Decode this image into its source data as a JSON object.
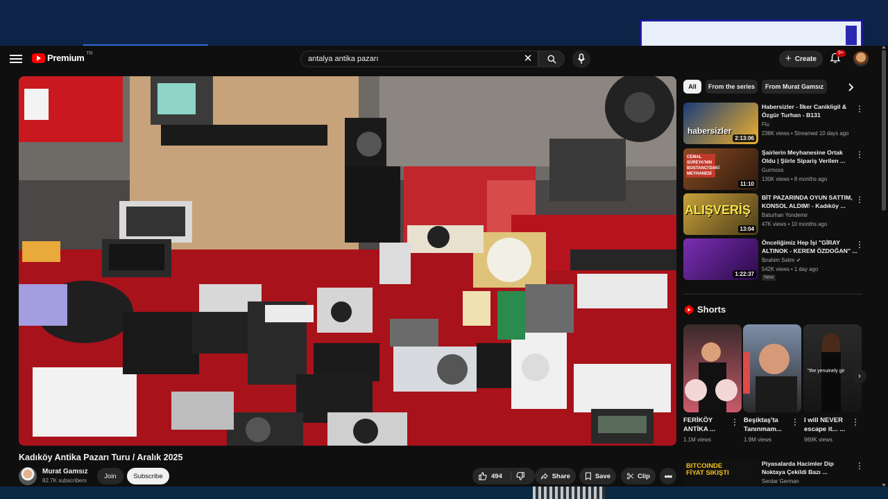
{
  "header": {
    "brand": "Premium",
    "region": "TR",
    "search_value": "antalya antika pazarı",
    "create_label": "Create",
    "notif_count": "9+"
  },
  "video": {
    "title": "Kadıköy Antika Pazarı Turu / Aralık 2025",
    "channel": "Murat Gamsız",
    "subscribers": "82.7K subscribers",
    "join_label": "Join",
    "subscribe_label": "Subscribe",
    "likes": "494",
    "share_label": "Share",
    "save_label": "Save",
    "clip_label": "Clip"
  },
  "chips": [
    "All",
    "From the series",
    "From Murat Gamsız"
  ],
  "recommendations": [
    {
      "title": "Habersizler - İlker Canikligil & Özgür Turhan - B131",
      "channel": "Flu",
      "meta": "238K views • Streamed 10 days ago",
      "duration": "2:13:06",
      "thumb_text": "habersizler",
      "thumb_color": "#1a3c7a"
    },
    {
      "title": "Şairlerin Meyhanesine Ortak Oldu | Şiirle Sipariş Verilen ...",
      "channel": "Gurmoss",
      "meta": "130K views • 8 months ago",
      "duration": "11:10",
      "thumb_text": "CEMAL SÜREYA'NIN BOSTANCI'DAKİ MEYHANESİ",
      "thumb_color": "#6b3a1f"
    },
    {
      "title": "BİT PAZARINDA OYUN SATTIM, KONSOL ALDIM! - Kadıköy ...",
      "channel": "Baturhan Yondemir",
      "meta": "47K views • 10 months ago",
      "duration": "13:04",
      "thumb_text": "ALIŞVERİŞ",
      "thumb_color": "#c9a33a"
    },
    {
      "title": "Önceliğimiz Hep İşi \"GİRAY ALTINOK - KEREM ÖZDOĞAN\" ...",
      "channel": "İbrahim Selim",
      "meta": "542K views • 1 day ago",
      "duration": "1:22:37",
      "badge": "New",
      "thumb_color": "#7a2fb0"
    },
    {
      "title": "Piyasalarda Hacimler Dip Noktaya Çekildi Bazı ...",
      "channel": "Serdar German",
      "meta": "",
      "duration": "",
      "thumb_text": "BITCOINDE FİYAT SIKIŞTI",
      "thumb_color": "#111111"
    }
  ],
  "shorts": {
    "heading": "Shorts",
    "items": [
      {
        "title": "FERİKÖY ANTİKA ...",
        "views": "1.1M views"
      },
      {
        "title": "Beşiktaş'ta Tanınmam...",
        "views": "1.9M views"
      },
      {
        "title": "I will NEVER escape it... ...",
        "views": "969K views",
        "overlay": "\"the yenuinely gir"
      }
    ]
  },
  "icons": {
    "menu": "hamburger-icon",
    "search": "search-icon",
    "mic": "mic-icon",
    "bell": "bell-icon",
    "like": "thumbs-up-icon",
    "dislike": "thumbs-down-icon",
    "share": "share-icon",
    "save": "bookmark-icon",
    "clip": "scissors-icon"
  },
  "colors": {
    "accent": "#ff0000",
    "background": "#0f0f0f",
    "chip_active": "#f1f1f1"
  }
}
